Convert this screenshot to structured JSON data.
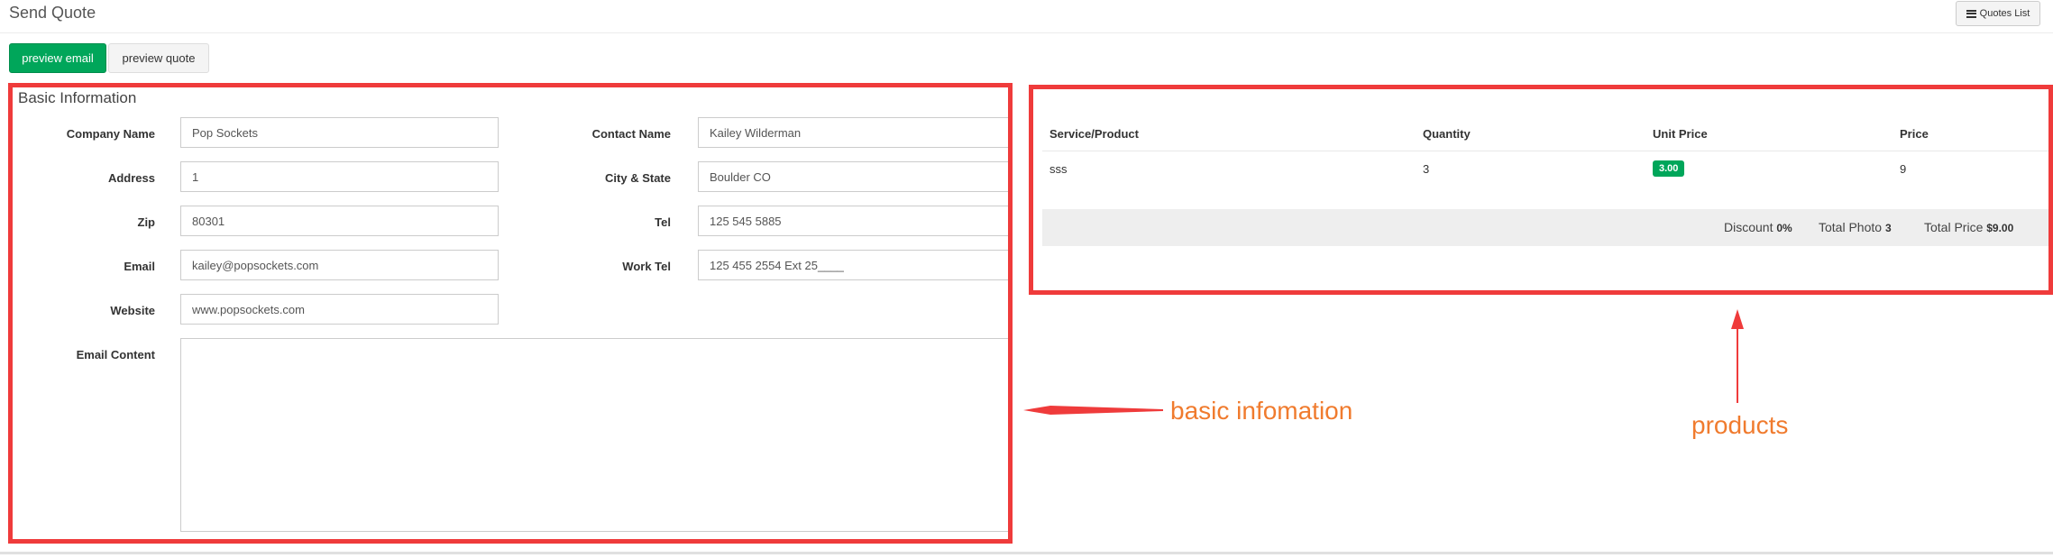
{
  "header": {
    "title": "Send Quote",
    "quotes_list_label": "Quotes List"
  },
  "actions": {
    "preview_email": "preview email",
    "preview_quote": "preview quote"
  },
  "basic_info": {
    "title": "Basic Information",
    "company_name": {
      "label": "Company Name",
      "value": "Pop Sockets"
    },
    "address": {
      "label": "Address",
      "value": "1"
    },
    "zip": {
      "label": "Zip",
      "value": "80301"
    },
    "email": {
      "label": "Email",
      "value": "kailey@popsockets.com"
    },
    "website": {
      "label": "Website",
      "value": "www.popsockets.com"
    },
    "contact_name": {
      "label": "Contact Name",
      "value": "Kailey  Wilderman"
    },
    "city_state": {
      "label": "City & State",
      "value": "Boulder  CO"
    },
    "tel": {
      "label": "Tel",
      "value": "125 545 5885"
    },
    "work_tel": {
      "label": "Work Tel",
      "value": "125 455 2554 Ext 25____"
    },
    "email_content": {
      "label": "Email Content",
      "value": ""
    }
  },
  "products": {
    "columns": [
      "Service/Product",
      "Quantity",
      "Unit Price",
      "Price"
    ],
    "rows": [
      {
        "product": "sss",
        "quantity": "3",
        "unit_price": "3.00",
        "price": "9"
      }
    ],
    "totals": {
      "discount_label": "Discount",
      "discount_value": "0%",
      "photo_label": "Total Photo",
      "photo_value": "3",
      "price_label": "Total Price",
      "price_value": "$9.00"
    }
  },
  "annotations": {
    "basic": "basic infomation",
    "products": "products"
  },
  "colors": {
    "annotation_red": "#ef3b3b",
    "annotation_orange": "#f07b2e",
    "primary_green": "#00a65a"
  },
  "icons": {
    "quotes_list": "list-icon"
  }
}
